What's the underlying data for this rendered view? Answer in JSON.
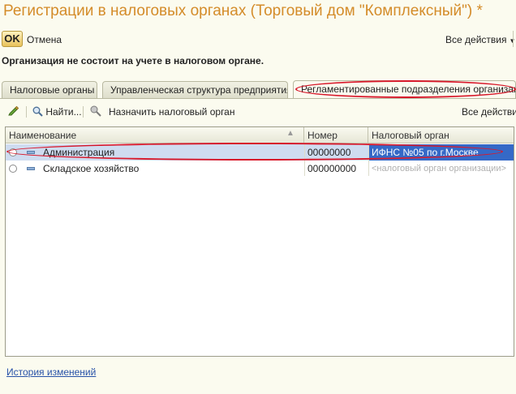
{
  "window": {
    "title": "Регистрации в налоговых органах (Торговый дом \"Комплексный\") *"
  },
  "topbar": {
    "ok_label": "OK",
    "cancel_label": "Отмена",
    "all_actions_label": "Все действия"
  },
  "notice": "Организация не состоит на учете в налоговом органе.",
  "tabs": [
    {
      "label": "Налоговые органы",
      "active": false
    },
    {
      "label": "Управленческая структура предприятия",
      "active": false
    },
    {
      "label": "Регламентированные подразделения организации",
      "active": true
    }
  ],
  "toolbar": {
    "find_label": "Найти...",
    "assign_label": "Назначить налоговый орган",
    "all_actions_label": "Все действия"
  },
  "table": {
    "columns": [
      "Наименование",
      "Номер",
      "Налоговый орган"
    ],
    "rows": [
      {
        "name": "Администрация",
        "number": "00000000",
        "tax_office": "ИФНС №05 по г.Москве",
        "selected": true
      },
      {
        "name": "Складское хозяйство",
        "number": "000000000",
        "tax_office": "<налоговый орган организации>",
        "selected": false
      }
    ]
  },
  "footer": {
    "history_link": "История изменений"
  },
  "colors": {
    "title": "#d48c2a",
    "highlight": "#d8192b",
    "selection": "#3569c7",
    "link": "#2852a8"
  }
}
